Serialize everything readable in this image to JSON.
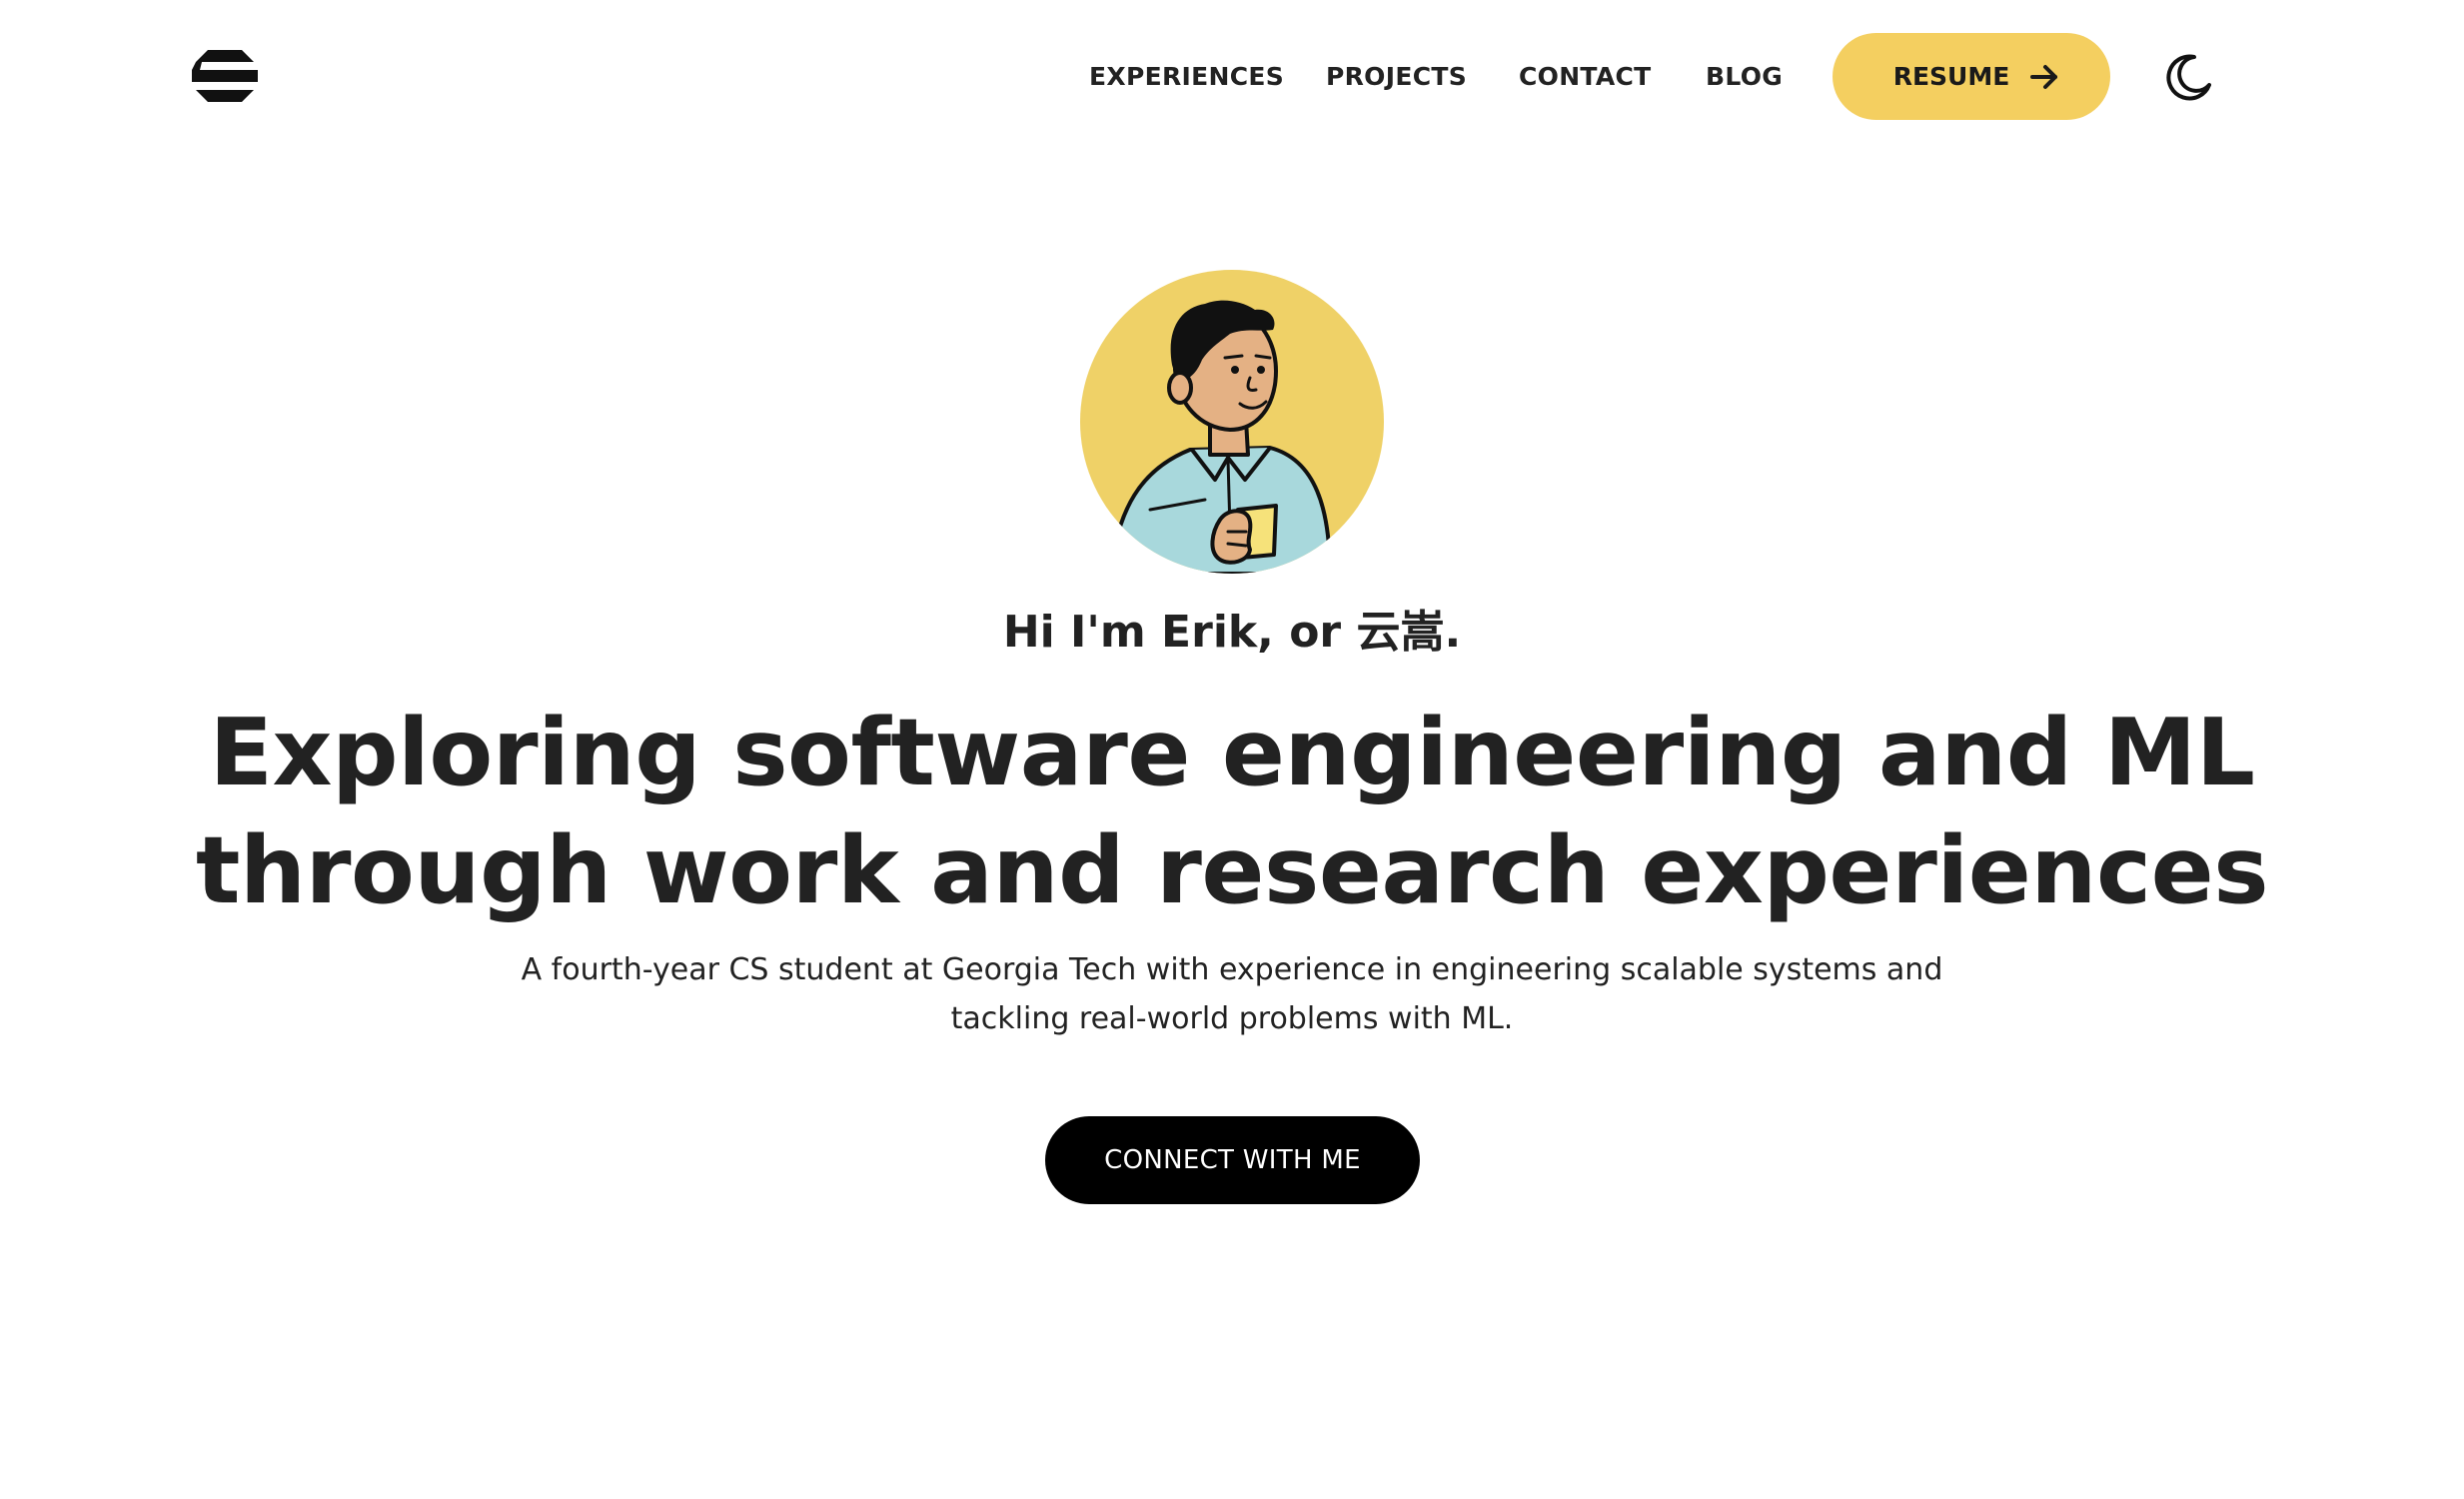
{
  "header": {
    "logo_icon": "e-logo-icon",
    "nav": [
      {
        "label": "EXPERIENCES"
      },
      {
        "label": "PROJECTS"
      },
      {
        "label": "CONTACT"
      },
      {
        "label": "BLOG"
      }
    ],
    "resume_label": "RESUME",
    "resume_icon": "arrow-right-icon",
    "theme_icon": "moon-icon"
  },
  "hero": {
    "avatar_icon": "avatar-illustration",
    "greeting": "Hi I'm Erik, or 云嵩.",
    "headline": "Exploring software engineering and ML through work and research experiences",
    "subtitle": "A fourth-year CS student at Georgia Tech with experience in engineering scalable systems and tackling real-world problems with ML.",
    "cta_label": "CONNECT WITH ME"
  },
  "colors": {
    "accent": "#f4cf60",
    "avatar_bg": "#efd167",
    "text": "#222222",
    "cta_bg": "#000000"
  }
}
